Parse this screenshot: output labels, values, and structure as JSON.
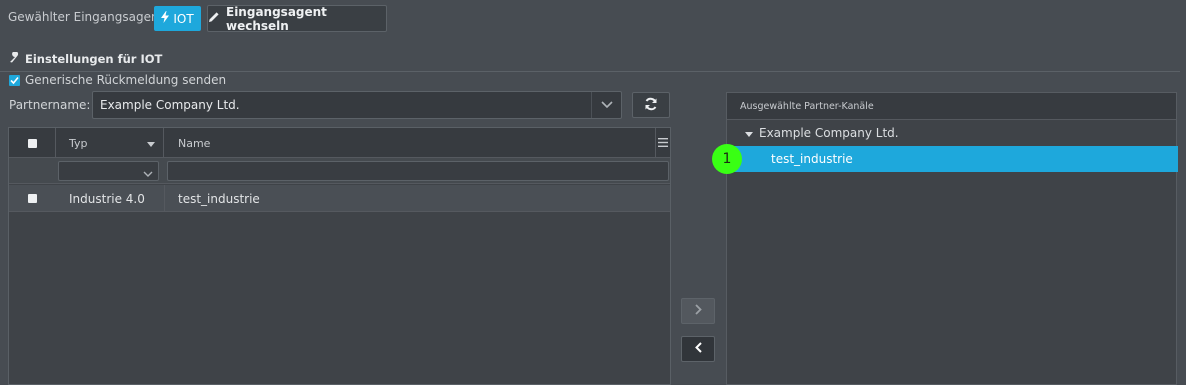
{
  "header": {
    "agent_label": "Gewählter Eingangsagent:",
    "agent_badge": "IOT",
    "switch_button": "Eingangsagent wechseln"
  },
  "settings": {
    "title": "Einstellungen für IOT",
    "generic_feedback_label": "Generische Rückmeldung senden",
    "generic_feedback_checked": true,
    "partner_label": "Partnername:",
    "partner_value": "Example Company Ltd."
  },
  "grid": {
    "columns": [
      "Typ",
      "Name"
    ],
    "rows": [
      {
        "typ": "Industrie 4.0",
        "name": "test_industrie"
      }
    ]
  },
  "right_panel": {
    "title": "Ausgewählte Partner-Kanäle",
    "tree_parent": "Example Company Ltd.",
    "tree_child": "test_industrie"
  },
  "marker": {
    "label": "1"
  },
  "colors": {
    "accent": "#1ea8dc",
    "marker": "#39ff14",
    "background": "#474c52"
  },
  "icons": [
    "bolt-icon",
    "pencil-icon",
    "wrench-icon",
    "check-icon",
    "chevron-down-icon",
    "refresh-icon",
    "menu-icon",
    "chevron-right-icon",
    "chevron-left-icon",
    "caret-down-icon"
  ]
}
